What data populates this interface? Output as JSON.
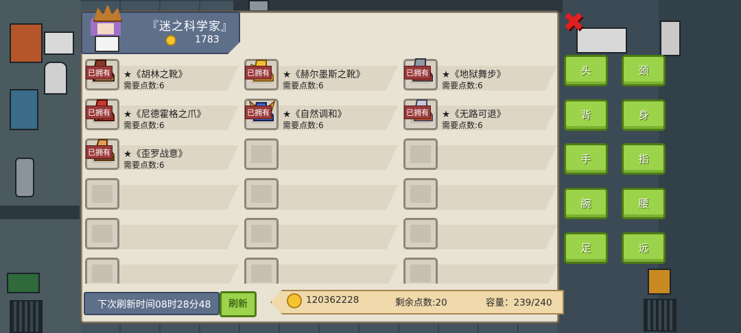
{
  "header": {
    "title": "『迷之科学家』",
    "gold": "1783"
  },
  "items": [
    {
      "name": "★《胡林之靴》",
      "cost": "需要点数:6",
      "owned_label": "已拥有",
      "owned": true,
      "icon": "boots-icon"
    },
    {
      "name": "★《赫尔墨斯之靴》",
      "cost": "需要点数:6",
      "owned_label": "已拥有",
      "owned": true,
      "icon": "winged-boots-icon"
    },
    {
      "name": "★《地狱舞步》",
      "cost": "需要点数:6",
      "owned_label": "已拥有",
      "owned": true,
      "icon": "hell-boots-icon"
    },
    {
      "name": "★《尼德霍格之爪》",
      "cost": "需要点数:6",
      "owned_label": "已拥有",
      "owned": true,
      "icon": "claw-boots-icon"
    },
    {
      "name": "★《自然调和》",
      "cost": "需要点数:6",
      "owned_label": "已拥有",
      "owned": true,
      "icon": "nature-boots-icon"
    },
    {
      "name": "★《无路可退》",
      "cost": "需要点数:6",
      "owned_label": "已拥有",
      "owned": true,
      "icon": "armored-boots-icon"
    },
    {
      "name": "★《歪罗战意》",
      "cost": "需要点数:6",
      "owned_label": "已拥有",
      "owned": true,
      "icon": "war-boots-icon"
    }
  ],
  "footer": {
    "refresh_time": "下次刷新时间08时28分48",
    "refresh_button": "刷新",
    "gold_total": "120362228",
    "points_left": "剩余点数:20",
    "capacity": "容量：239/240"
  },
  "categories": [
    "头",
    "颈",
    "背",
    "身",
    "手",
    "指",
    "腕",
    "腰",
    "足",
    "远"
  ],
  "colors": {
    "panel": "#e9e3d4",
    "header": "#5e6f8a",
    "button_green": "#9bd44a",
    "owned_tag": "#9a3a3a",
    "close_red": "#e02020"
  }
}
